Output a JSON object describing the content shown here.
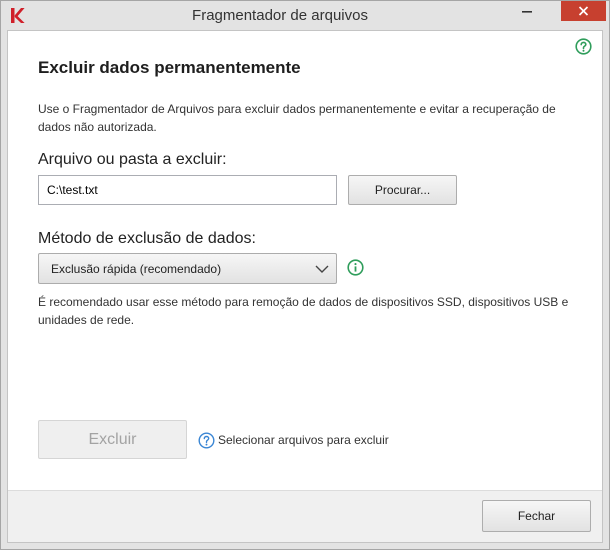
{
  "window": {
    "title": "Fragmentador de arquivos"
  },
  "colors": {
    "titlebar": "#e3e3e3",
    "close_button": "#c7402f",
    "help_green": "#2f9d5b",
    "hint_blue": "#3a86d4",
    "disabled_text": "#a3a3a3"
  },
  "icons": {
    "app_logo": "kaspersky-logo-icon",
    "minimize": "minimize-icon",
    "close": "close-icon",
    "help": "help-icon",
    "info": "info-icon",
    "dropdown": "chevron-down-icon",
    "hint": "question-circle-icon"
  },
  "main": {
    "heading": "Excluir dados permanentemente",
    "description": "Use o Fragmentador de Arquivos para excluir dados permanentemente e evitar a recuperação de dados não autorizada.",
    "file_section": {
      "label": "Arquivo ou pasta a excluir:",
      "path_value": "C:\\test.txt",
      "browse_label": "Procurar..."
    },
    "method_section": {
      "label": "Método de exclusão de dados:",
      "selected_method": "Exclusão rápida (recomendado)",
      "note": "É recomendado usar esse método para remoção de dados de dispositivos SSD, dispositivos USB e unidades de rede."
    },
    "actions": {
      "delete_label": "Excluir",
      "delete_enabled": false,
      "hint": "Selecionar arquivos para excluir"
    }
  },
  "footer": {
    "close_label": "Fechar"
  }
}
